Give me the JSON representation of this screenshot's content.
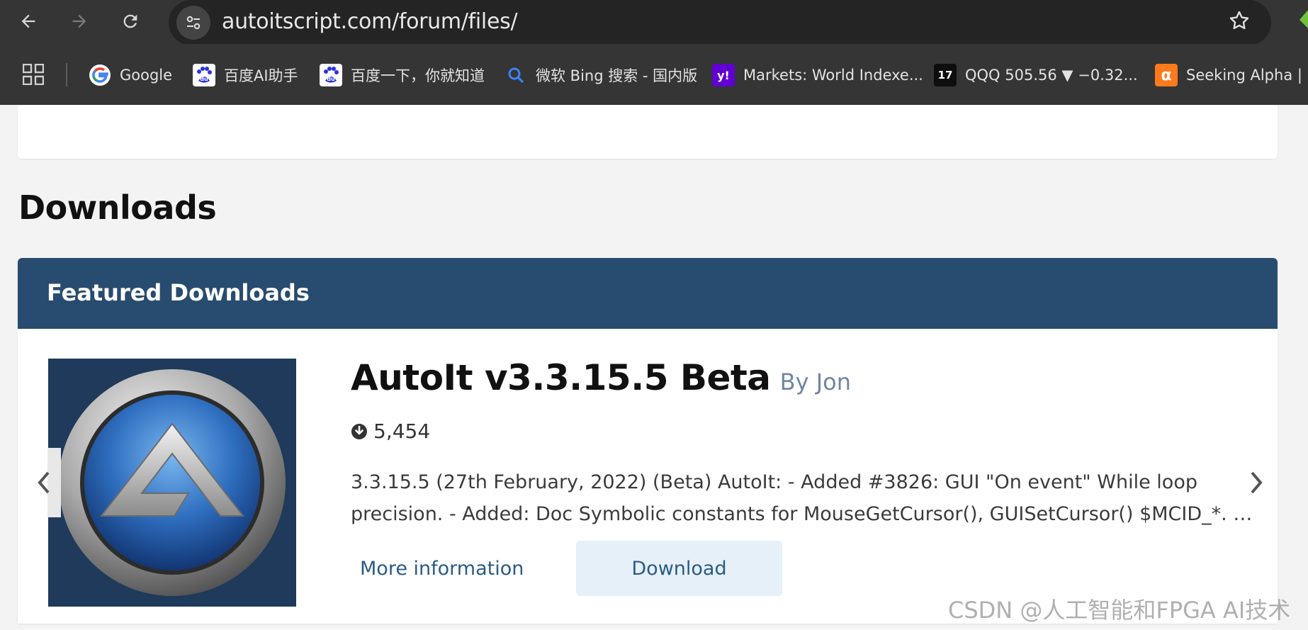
{
  "browser": {
    "url": "autoitscript.com/forum/files/",
    "nav_icons": [
      "back-arrow-icon",
      "forward-arrow-icon",
      "reload-icon"
    ],
    "bookmarks": [
      {
        "label": "Google",
        "icon": "google-icon"
      },
      {
        "label": "百度AI助手",
        "icon": "baidu-icon"
      },
      {
        "label": "百度一下，你就知道",
        "icon": "baidu-icon"
      },
      {
        "label": "微软 Bing 搜索 - 国内版",
        "icon": "bing-search-icon"
      },
      {
        "label": "Markets: World Indexe...",
        "icon": "yahoo-icon"
      },
      {
        "label": "QQQ 505.56 ▼ −0.32...",
        "icon": "tradingview-icon"
      },
      {
        "label": "Seeking Alpha | St",
        "icon": "seeking-alpha-icon"
      }
    ]
  },
  "page": {
    "heading": "Downloads",
    "featured": {
      "title": "Featured Downloads",
      "item": {
        "name": "AutoIt v3.3.15.5 Beta",
        "author": "By Jon",
        "downloads": "5,454",
        "description_line1": "3.3.15.5 (27th February, 2022) (Beta) AutoIt: - Added #3826: GUI \"On event\" While loop",
        "description_line2": "precision. - Added: Doc Symbolic constants for MouseGetCursor(), GUISetCursor()  $MCID_*. - ...",
        "more_info_label": "More information",
        "download_label": "Download",
        "thumbnail_icon": "autoit-logo-icon"
      }
    }
  },
  "watermark": "CSDN @人工智能和FPGA AI技术",
  "colors": {
    "chrome_bg": "#353535",
    "header_blue": "#284c6f",
    "link_blue": "#2b5b84",
    "button_bg": "#e6f0f8"
  }
}
